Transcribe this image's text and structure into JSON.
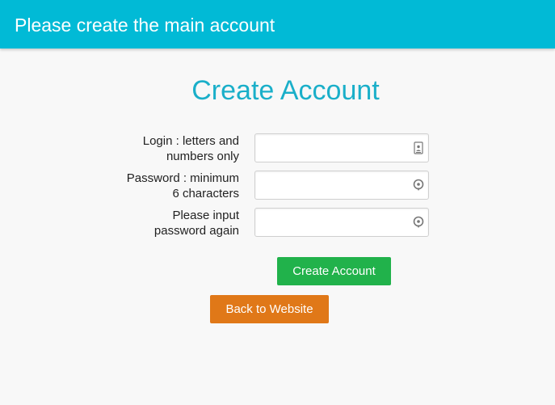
{
  "header": {
    "title": "Please create the main account",
    "bg_color": "#01bad6"
  },
  "form": {
    "title": "Create Account",
    "fields": [
      {
        "label_line1": "Login : letters and",
        "label_line2": "numbers only",
        "value": "",
        "icon": "contact-card-icon"
      },
      {
        "label_line1": "Password : minimum",
        "label_line2": "6 characters",
        "value": "",
        "icon": "password-key-icon"
      },
      {
        "label_line1": "Please input",
        "label_line2": "password again",
        "value": "",
        "icon": "password-key-icon"
      }
    ],
    "submit_label": "Create Account",
    "submit_color": "#21b24b",
    "back_label": "Back to Website",
    "back_color": "#e07818",
    "title_color": "#1aafc9"
  }
}
